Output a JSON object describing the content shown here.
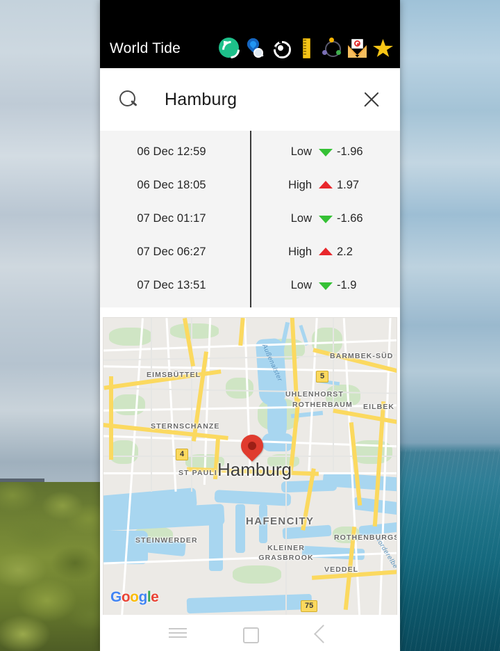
{
  "wallpaper": {
    "left_scene": "cloudy-sky-over-forested-hillside",
    "right_scene": "cloudy-sky-over-ocean"
  },
  "appbar": {
    "title": "World Tide",
    "background": "#000000",
    "icons": [
      {
        "name": "sync-icon",
        "label": "Sync",
        "color": "#1ec08a"
      },
      {
        "name": "location-search-icon",
        "label": "Search location",
        "color": "#2196f3"
      },
      {
        "name": "crosshair-icon",
        "label": "My location",
        "color": "#ffffff"
      },
      {
        "name": "ruler-icon",
        "label": "Units",
        "color": "#f5c518"
      },
      {
        "name": "orbit-icon",
        "label": "Moon phase",
        "color": "#5a5a6e"
      },
      {
        "name": "mail-icon",
        "label": "Contact",
        "color": "#f2a93b"
      },
      {
        "name": "star-icon",
        "label": "Favourites",
        "color": "#f7c516"
      }
    ]
  },
  "search": {
    "value": "Hamburg",
    "placeholder": "Search",
    "search_icon": "search-icon",
    "clear_icon": "close-icon"
  },
  "tides": {
    "rows": [
      {
        "when": "06 Dec 12:59",
        "type": "Low",
        "arrow": "down",
        "height": "-1.96"
      },
      {
        "when": "06 Dec 18:05",
        "type": "High",
        "arrow": "up",
        "height": "1.97"
      },
      {
        "when": "07 Dec 01:17",
        "type": "Low",
        "arrow": "down",
        "height": "-1.66"
      },
      {
        "when": "07 Dec 06:27",
        "type": "High",
        "arrow": "up",
        "height": "2.2"
      },
      {
        "when": "07 Dec 13:51",
        "type": "Low",
        "arrow": "down",
        "height": "-1.9"
      }
    ],
    "low_color": "#35c135",
    "high_color": "#e8272c"
  },
  "map": {
    "marker_label": "Hamburg",
    "attribution": "Google",
    "attribution_letters": [
      "G",
      "o",
      "o",
      "g",
      "l",
      "e"
    ],
    "districts": [
      "EIMSBÜTTEL",
      "ROTHERBAUM",
      "STERNSCHANZE",
      "BARMBEK-SÜD",
      "UHLENHORST",
      "EILBEK",
      "ST PAULI",
      "HAFENCITY",
      "STEINWERDER",
      "KLEINER GRASBROOK",
      "VEDDEL",
      "ROTHENBURGSORT"
    ],
    "water_labels": [
      "Außenalster",
      "Norderelbe"
    ],
    "road_shields": [
      "5",
      "4",
      "75"
    ]
  },
  "navbar": {
    "buttons": [
      {
        "name": "recents-button",
        "icon": "menu-icon"
      },
      {
        "name": "home-button",
        "icon": "square-icon"
      },
      {
        "name": "back-button",
        "icon": "back-triangle-icon"
      }
    ]
  }
}
